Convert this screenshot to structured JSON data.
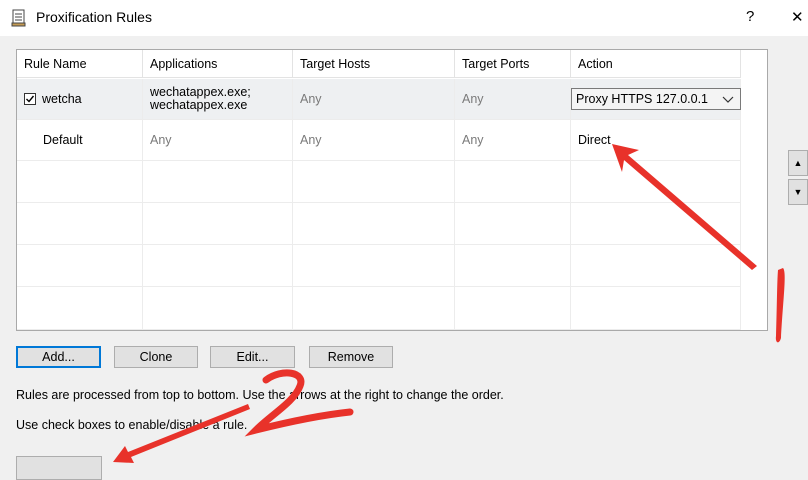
{
  "window": {
    "title": "Proxification Rules",
    "help": "?",
    "close": "✕"
  },
  "table": {
    "headers": [
      "Rule Name",
      "Applications",
      "Target Hosts",
      "Target Ports",
      "Action"
    ],
    "rows": [
      {
        "checked": true,
        "name": "wetcha",
        "apps_line1": "wechatappex.exe;",
        "apps_line2": "wechatappex.exe",
        "hosts": "Any",
        "ports": "Any",
        "action": "Proxy HTTPS 127.0.0.1"
      },
      {
        "name": "Default",
        "apps": "Any",
        "hosts": "Any",
        "ports": "Any",
        "action": "Direct"
      }
    ]
  },
  "buttons": {
    "add": "Add...",
    "clone": "Clone",
    "edit": "Edit...",
    "remove": "Remove"
  },
  "hints": {
    "order": "Rules are processed from top to bottom. Use the arrows at the right to change the order.",
    "enable": "Use check boxes to enable/disable a rule."
  },
  "colors": {
    "annotation": "#e8322a",
    "focus": "#0078d7"
  }
}
